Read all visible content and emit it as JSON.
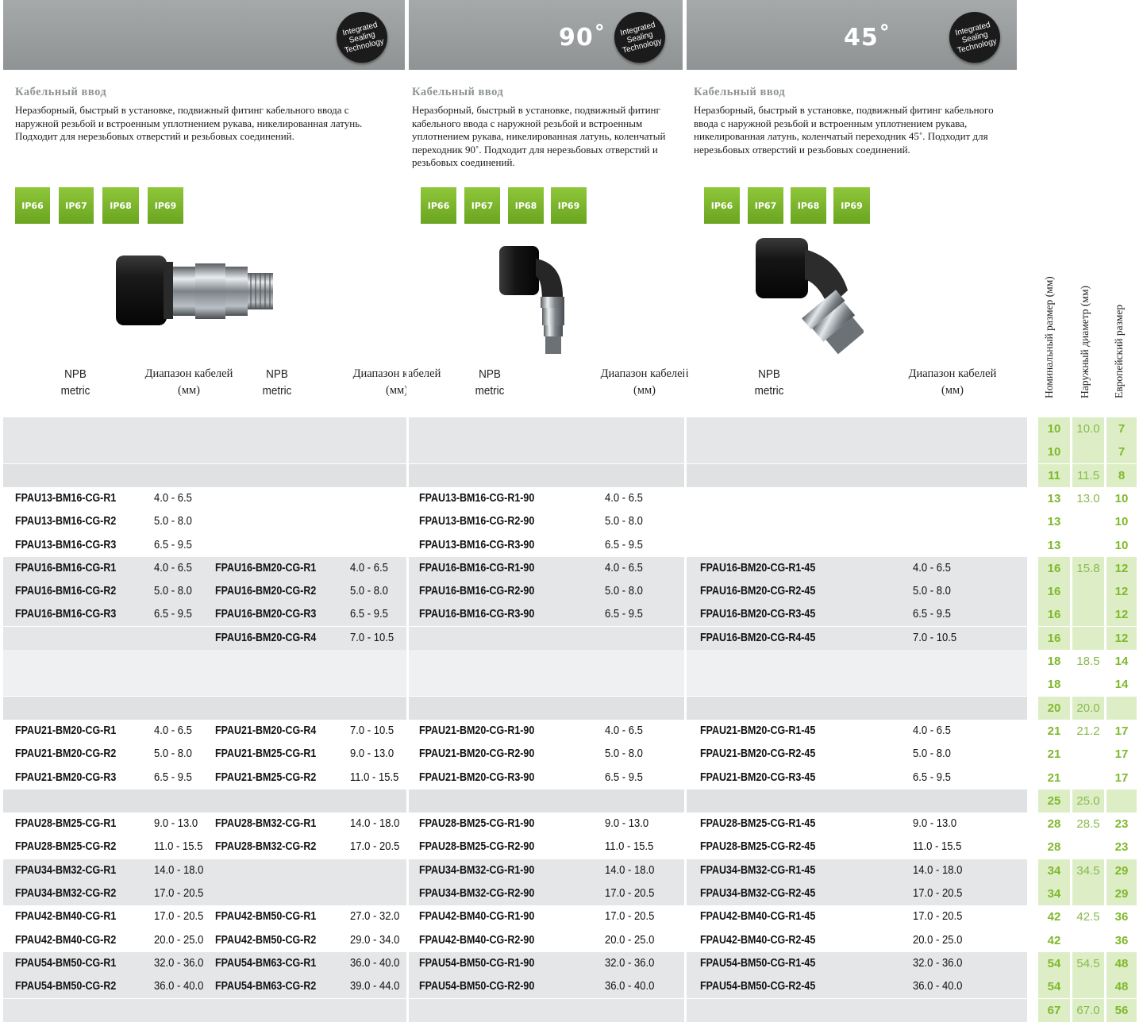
{
  "panels": [
    {
      "angle": "",
      "badge": "Integrated\nSealing\nTechnology",
      "title": "Кабельный ввод",
      "desc": "Неразборный, быстрый в установке, подвижный фитинг кабельного ввода с наружной резьбой и встроенным уплотнением  рукава, никелированная латунь. Подходит для  нерезьбовых отверстий и резьбовых соединений.",
      "ip": [
        "IP66",
        "IP67",
        "IP68",
        "IP69"
      ]
    },
    {
      "angle": "90˚",
      "badge": "Integrated\nSealing\nTechnology",
      "title": "Кабельный ввод",
      "desc": "Неразборный, быстрый в установке, подвижный фитинг кабельного ввода с наружной резьбой и встроенным уплотнением  рукава, никелированная латунь, коленчатый переходник 90˚. Подходит для нерезьбовых отверстий и резьбовых соединений.",
      "ip": [
        "IP66",
        "IP67",
        "IP68",
        "IP69"
      ]
    },
    {
      "angle": "45˚",
      "badge": "Integrated\nSealing\nTechnology",
      "title": "Кабельный ввод",
      "desc": "Неразборный, быстрый в установке, подвижный фитинг кабельного ввода с наружной резьбой и встроенным уплотнением  рукава, никелированная латунь, коленчатый переходник 45˚. Подходит для  нерезьбовых отверстий и резьбовых соединений.",
      "ip": [
        "IP66",
        "IP67",
        "IP68",
        "IP69"
      ]
    }
  ],
  "column_headers": {
    "npb": "NPB\nmetric",
    "range": "Диапазон кабелей\n(мм)",
    "nominal": "Номинальный размер (мм)",
    "outer": "Наружный диаметр (мм)",
    "euro": "Европейский размер"
  },
  "colors": {
    "green": "#7fb82b",
    "green_bg": "#ddeec7",
    "grey_row": "#e4e6e7",
    "white_row": "#ffffff",
    "header_grey": "#9c9fa0"
  },
  "rows": [
    {
      "shade": "g",
      "c1": "",
      "r1": "",
      "c2": "",
      "r2": "",
      "c3": "",
      "r3": "",
      "c4": "",
      "r4": "",
      "nom": "10",
      "od": "10.0",
      "eu": "7"
    },
    {
      "shade": "g",
      "c1": "",
      "r1": "",
      "c2": "",
      "r2": "",
      "c3": "",
      "r3": "",
      "c4": "",
      "r4": "",
      "nom": "10",
      "od": "",
      "eu": "7"
    },
    {
      "shade": "d",
      "c1": "",
      "r1": "",
      "c2": "",
      "r2": "",
      "c3": "",
      "r3": "",
      "c4": "",
      "r4": "",
      "nom": "11",
      "od": "11.5",
      "eu": "8"
    },
    {
      "shade": "w",
      "c1": "FPAU13-BM16-CG-R1",
      "r1": "4.0 - 6.5",
      "c2": "",
      "r2": "",
      "c3": "FPAU13-BM16-CG-R1-90",
      "r3": "4.0 - 6.5",
      "c4": "",
      "r4": "",
      "nom": "13",
      "od": "13.0",
      "eu": "10"
    },
    {
      "shade": "w",
      "c1": "FPAU13-BM16-CG-R2",
      "r1": "5.0 - 8.0",
      "c2": "",
      "r2": "",
      "c3": "FPAU13-BM16-CG-R2-90",
      "r3": "5.0 - 8.0",
      "c4": "",
      "r4": "",
      "nom": "13",
      "od": "",
      "eu": "10"
    },
    {
      "shade": "w",
      "c1": "FPAU13-BM16-CG-R3",
      "r1": "6.5 - 9.5",
      "c2": "",
      "r2": "",
      "c3": "FPAU13-BM16-CG-R3-90",
      "r3": "6.5 - 9.5",
      "c4": "",
      "r4": "",
      "nom": "13",
      "od": "",
      "eu": "10"
    },
    {
      "shade": "g",
      "c1": "FPAU16-BM16-CG-R1",
      "r1": "4.0 - 6.5",
      "c2": "FPAU16-BM20-CG-R1",
      "r2": "4.0 - 6.5",
      "c3": "FPAU16-BM16-CG-R1-90",
      "r3": "4.0 - 6.5",
      "c4": "FPAU16-BM20-CG-R1-45",
      "r4": "4.0 - 6.5",
      "nom": "16",
      "od": "15.8",
      "eu": "12"
    },
    {
      "shade": "g",
      "c1": "FPAU16-BM16-CG-R2",
      "r1": "5.0 - 8.0",
      "c2": "FPAU16-BM20-CG-R2",
      "r2": "5.0 - 8.0",
      "c3": "FPAU16-BM16-CG-R2-90",
      "r3": "5.0 - 8.0",
      "c4": "FPAU16-BM20-CG-R2-45",
      "r4": "5.0 - 8.0",
      "nom": "16",
      "od": "",
      "eu": "12"
    },
    {
      "shade": "g",
      "c1": "FPAU16-BM16-CG-R3",
      "r1": "6.5 - 9.5",
      "c2": "FPAU16-BM20-CG-R3",
      "r2": "6.5 - 9.5",
      "c3": "FPAU16-BM16-CG-R3-90",
      "r3": "6.5 - 9.5",
      "c4": "FPAU16-BM20-CG-R3-45",
      "r4": "6.5 - 9.5",
      "nom": "16",
      "od": "",
      "eu": "12"
    },
    {
      "shade": "g",
      "c1": "",
      "r1": "",
      "c2": "FPAU16-BM20-CG-R4",
      "r2": "7.0 - 10.5",
      "c3": "",
      "r3": "",
      "c4": "FPAU16-BM20-CG-R4-45",
      "r4": "7.0 - 10.5",
      "nom": "16",
      "od": "",
      "eu": "12"
    },
    {
      "shade": "w",
      "c1": "",
      "r1": "",
      "c2": "",
      "r2": "",
      "c3": "",
      "r3": "",
      "c4": "",
      "r4": "",
      "nom": "18",
      "od": "18.5",
      "eu": "14"
    },
    {
      "shade": "w",
      "c1": "",
      "r1": "",
      "c2": "",
      "r2": "",
      "c3": "",
      "r3": "",
      "c4": "",
      "r4": "",
      "nom": "18",
      "od": "",
      "eu": "14"
    },
    {
      "shade": "d",
      "c1": "",
      "r1": "",
      "c2": "",
      "r2": "",
      "c3": "",
      "r3": "",
      "c4": "",
      "r4": "",
      "nom": "20",
      "od": "20.0",
      "eu": ""
    },
    {
      "shade": "w",
      "c1": "FPAU21-BM20-CG-R1",
      "r1": "4.0 - 6.5",
      "c2": "FPAU21-BM20-CG-R4",
      "r2": "7.0 - 10.5",
      "c3": "FPAU21-BM20-CG-R1-90",
      "r3": "4.0 - 6.5",
      "c4": "FPAU21-BM20-CG-R1-45",
      "r4": "4.0 - 6.5",
      "nom": "21",
      "od": "21.2",
      "eu": "17"
    },
    {
      "shade": "w",
      "c1": "FPAU21-BM20-CG-R2",
      "r1": "5.0 - 8.0",
      "c2": "FPAU21-BM25-CG-R1",
      "r2": "9.0 - 13.0",
      "c3": "FPAU21-BM20-CG-R2-90",
      "r3": "5.0 - 8.0",
      "c4": "FPAU21-BM20-CG-R2-45",
      "r4": "5.0 - 8.0",
      "nom": "21",
      "od": "",
      "eu": "17"
    },
    {
      "shade": "w",
      "c1": "FPAU21-BM20-CG-R3",
      "r1": "6.5 - 9.5",
      "c2": "FPAU21-BM25-CG-R2",
      "r2": "11.0 - 15.5",
      "c3": "FPAU21-BM20-CG-R3-90",
      "r3": "6.5 - 9.5",
      "c4": "FPAU21-BM20-CG-R3-45",
      "r4": "6.5 - 9.5",
      "nom": "21",
      "od": "",
      "eu": "17"
    },
    {
      "shade": "d",
      "c1": "",
      "r1": "",
      "c2": "",
      "r2": "",
      "c3": "",
      "r3": "",
      "c4": "",
      "r4": "",
      "nom": "25",
      "od": "25.0",
      "eu": ""
    },
    {
      "shade": "w",
      "c1": "FPAU28-BM25-CG-R1",
      "r1": "9.0 - 13.0",
      "c2": "FPAU28-BM32-CG-R1",
      "r2": "14.0 - 18.0",
      "c3": "FPAU28-BM25-CG-R1-90",
      "r3": "9.0 - 13.0",
      "c4": "FPAU28-BM25-CG-R1-45",
      "r4": "9.0 - 13.0",
      "nom": "28",
      "od": "28.5",
      "eu": "23"
    },
    {
      "shade": "w",
      "c1": "FPAU28-BM25-CG-R2",
      "r1": "11.0 - 15.5",
      "c2": "FPAU28-BM32-CG-R2",
      "r2": "17.0 - 20.5",
      "c3": "FPAU28-BM25-CG-R2-90",
      "r3": "11.0 - 15.5",
      "c4": "FPAU28-BM25-CG-R2-45",
      "r4": "11.0 - 15.5",
      "nom": "28",
      "od": "",
      "eu": "23"
    },
    {
      "shade": "g",
      "c1": "FPAU34-BM32-CG-R1",
      "r1": "14.0 - 18.0",
      "c2": "",
      "r2": "",
      "c3": "FPAU34-BM32-CG-R1-90",
      "r3": "14.0 - 18.0",
      "c4": "FPAU34-BM32-CG-R1-45",
      "r4": "14.0 - 18.0",
      "nom": "34",
      "od": "34.5",
      "eu": "29"
    },
    {
      "shade": "g",
      "c1": "FPAU34-BM32-CG-R2",
      "r1": "17.0 - 20.5",
      "c2": "",
      "r2": "",
      "c3": "FPAU34-BM32-CG-R2-90",
      "r3": "17.0 - 20.5",
      "c4": "FPAU34-BM32-CG-R2-45",
      "r4": "17.0 - 20.5",
      "nom": "34",
      "od": "",
      "eu": "29"
    },
    {
      "shade": "w",
      "c1": "FPAU42-BM40-CG-R1",
      "r1": "17.0 - 20.5",
      "c2": "FPAU42-BM50-CG-R1",
      "r2": "27.0 - 32.0",
      "c3": "FPAU42-BM40-CG-R1-90",
      "r3": "17.0 - 20.5",
      "c4": "FPAU42-BM40-CG-R1-45",
      "r4": "17.0 - 20.5",
      "nom": "42",
      "od": "42.5",
      "eu": "36"
    },
    {
      "shade": "w",
      "c1": "FPAU42-BM40-CG-R2",
      "r1": "20.0 - 25.0",
      "c2": "FPAU42-BM50-CG-R2",
      "r2": "29.0 - 34.0",
      "c3": "FPAU42-BM40-CG-R2-90",
      "r3": "20.0 - 25.0",
      "c4": "FPAU42-BM40-CG-R2-45",
      "r4": "20.0 - 25.0",
      "nom": "42",
      "od": "",
      "eu": "36"
    },
    {
      "shade": "g",
      "c1": "FPAU54-BM50-CG-R1",
      "r1": "32.0 - 36.0",
      "c2": "FPAU54-BM63-CG-R1",
      "r2": "36.0 - 40.0",
      "c3": "FPAU54-BM50-CG-R1-90",
      "r3": "32.0 - 36.0",
      "c4": "FPAU54-BM50-CG-R1-45",
      "r4": "32.0 - 36.0",
      "nom": "54",
      "od": "54.5",
      "eu": "48"
    },
    {
      "shade": "g",
      "c1": "FPAU54-BM50-CG-R2",
      "r1": "36.0 - 40.0",
      "c2": "FPAU54-BM63-CG-R2",
      "r2": "39.0 - 44.0",
      "c3": "FPAU54-BM50-CG-R2-90",
      "r3": "36.0 - 40.0",
      "c4": "FPAU54-BM50-CG-R2-45",
      "r4": "36.0 - 40.0",
      "nom": "54",
      "od": "",
      "eu": "48"
    },
    {
      "shade": "g",
      "c1": "",
      "r1": "",
      "c2": "",
      "r2": "",
      "c3": "",
      "r3": "",
      "c4": "",
      "r4": "",
      "nom": "67",
      "od": "67.0",
      "eu": "56"
    }
  ]
}
